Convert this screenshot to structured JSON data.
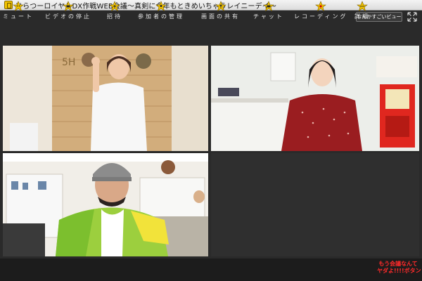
{
  "window": {
    "title": "ひらつーロイヤルDX作戦WEB会議～真剣に今年もときめいちゃうレイニーデイ～"
  },
  "top_controls": {
    "view_label": "なんかすごいビュー",
    "fullscreen_icon": "fullscreen-icon"
  },
  "tiles": [
    {
      "name": "participant-1",
      "scene": "wood-panel-wall"
    },
    {
      "name": "participant-2",
      "scene": "office-kitchen"
    },
    {
      "name": "participant-3",
      "scene": "open-office"
    },
    {
      "name": "empty-slot",
      "scene": "empty"
    }
  ],
  "toolbar": {
    "items": [
      {
        "label": "ミュート",
        "icon": "mute-icon"
      },
      {
        "label": "ビデオの停止",
        "icon": "video-stop-icon"
      },
      {
        "label": "招待",
        "icon": "invite-icon"
      },
      {
        "label": "参加者の管理",
        "icon": "participants-icon"
      },
      {
        "label": "画面の共有",
        "icon": "share-screen-icon"
      },
      {
        "label": "チャット",
        "icon": "chat-icon"
      },
      {
        "label": "レコーディング",
        "icon": "recording-icon"
      },
      {
        "label": "詳細",
        "icon": "more-icon"
      }
    ],
    "special_button": {
      "line1": "もう会議なんて",
      "line2": "ヤダよ!!!!ボタン",
      "color": "#ff2a2a"
    }
  },
  "colors": {
    "background": "#2a2a2a",
    "toolbar": "#1c1c1c",
    "icon_yellow": "#f2c400"
  }
}
